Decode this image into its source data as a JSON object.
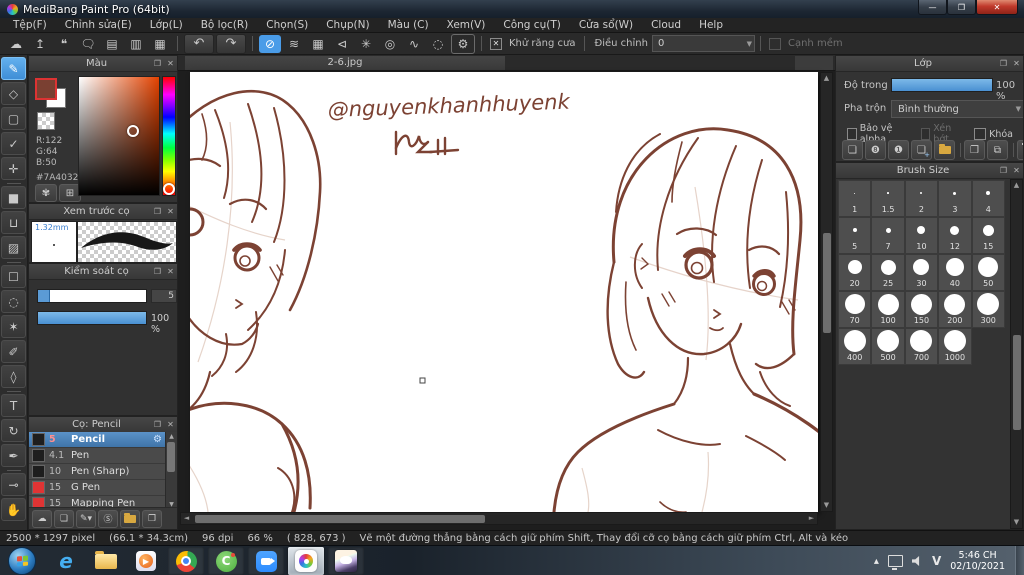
{
  "window": {
    "title": "MediBang Paint Pro (64bit)"
  },
  "menu": {
    "items": [
      "Tệp(F)",
      "Chỉnh sửa(E)",
      "Lớp(L)",
      "Bộ lọc(R)",
      "Chọn(S)",
      "Chụp(N)",
      "Màu (C)",
      "Xem(V)",
      "Công cụ(T)",
      "Cửa sổ(W)",
      "Cloud",
      "Help"
    ]
  },
  "toolbar": {
    "groups": [
      {
        "items": [
          {
            "name": "cloud-save-icon",
            "glyph": "☁"
          },
          {
            "name": "upload-icon",
            "glyph": "↥"
          },
          {
            "name": "comment-icon",
            "glyph": "❝"
          },
          {
            "name": "comment-list-icon",
            "glyph": "🗨"
          },
          {
            "name": "document-icon",
            "glyph": "▤"
          },
          {
            "name": "panel-list-icon",
            "glyph": "▥"
          },
          {
            "name": "table-edit-icon",
            "glyph": "▦"
          }
        ]
      },
      {
        "items": [
          {
            "name": "undo-icon",
            "glyph": "↶",
            "wide": true
          },
          {
            "name": "redo-icon",
            "glyph": "↷",
            "wide": true
          }
        ]
      },
      {
        "items": [
          {
            "name": "snap-off-icon",
            "glyph": "⊘",
            "active": true
          },
          {
            "name": "snap-parallel-icon",
            "glyph": "≋"
          },
          {
            "name": "snap-grid-icon",
            "glyph": "▦"
          },
          {
            "name": "snap-vanishing-icon",
            "glyph": "⊲"
          },
          {
            "name": "snap-radial-icon",
            "glyph": "✳"
          },
          {
            "name": "snap-concentric-icon",
            "glyph": "◎"
          },
          {
            "name": "snap-curve-icon",
            "glyph": "∿"
          },
          {
            "name": "snap-ellipse-icon",
            "glyph": "◌"
          },
          {
            "name": "snap-settings-icon",
            "glyph": "⚙",
            "boxed": true
          }
        ]
      }
    ],
    "antialias_label": "Khử răng cưa",
    "antialias_checked": true,
    "adjust_label": "Điều chỉnh",
    "adjust_value": "0",
    "soft_edge_label": "Cạnh mềm",
    "soft_edge_checked": false
  },
  "toolstrip": {
    "tools": [
      {
        "name": "brush-tool",
        "glyph": "✎",
        "selected": true
      },
      {
        "name": "eraser-tool",
        "glyph": "◇"
      },
      {
        "name": "shape-brush-tool",
        "glyph": "▢"
      },
      {
        "name": "snap-pen-tool",
        "glyph": "✓"
      },
      {
        "name": "move-tool",
        "glyph": "✛",
        "sep_after": true
      },
      {
        "name": "fill-rect-tool",
        "glyph": "■"
      },
      {
        "name": "bucket-tool",
        "glyph": "⊔"
      },
      {
        "name": "gradient-tool",
        "glyph": "▨",
        "sep_after": true
      },
      {
        "name": "select-rect-tool",
        "glyph": "☐"
      },
      {
        "name": "lasso-tool",
        "glyph": "◌"
      },
      {
        "name": "magic-wand-tool",
        "glyph": "✶"
      },
      {
        "name": "select-pen-tool",
        "glyph": "✐"
      },
      {
        "name": "select-eraser-tool",
        "glyph": "◊",
        "sep_after": true
      },
      {
        "name": "text-tool",
        "glyph": "T"
      },
      {
        "name": "operation-tool",
        "glyph": "↻"
      },
      {
        "name": "line-pen-tool",
        "glyph": "✒",
        "sep_after": true
      },
      {
        "name": "eyedropper-tool",
        "glyph": "⊸"
      },
      {
        "name": "hand-tool",
        "glyph": "✋"
      }
    ]
  },
  "color_panel": {
    "title": "Màu",
    "r": "R:122",
    "g": "G:64",
    "b": "B:50",
    "hex": "#7A4032",
    "buttons": [
      {
        "name": "palette-icon",
        "glyph": "✾"
      },
      {
        "name": "palette-add-icon",
        "glyph": "⊞"
      }
    ]
  },
  "brush_preview": {
    "title": "Xem trước cọ",
    "size_label": "1.32mm"
  },
  "brush_control": {
    "title": "Kiểm soát cọ",
    "size_value": "5",
    "opacity_value": "100 %"
  },
  "brush_list": {
    "title": "Cọ: Pencil",
    "items": [
      {
        "size": "5",
        "name": "Pencil",
        "selected": true,
        "swatch": "#1e1e1e"
      },
      {
        "size": "4.1",
        "name": "Pen",
        "swatch": "#1e1e1e"
      },
      {
        "size": "10",
        "name": "Pen (Sharp)",
        "swatch": "#1e1e1e"
      },
      {
        "size": "15",
        "name": "G Pen",
        "swatch": "#e03434"
      },
      {
        "size": "15",
        "name": "Mapping Pen",
        "swatch": "#e03434"
      }
    ],
    "footer_icons": [
      {
        "name": "cloud-brush-icon",
        "glyph": "☁"
      },
      {
        "name": "new-brush-icon",
        "glyph": "❏"
      },
      {
        "name": "edit-brush-icon",
        "glyph": "✎▾"
      },
      {
        "name": "script-brush-icon",
        "glyph": "Ⓢ"
      },
      {
        "name": "brush-folder-icon",
        "kind": "folder"
      },
      {
        "name": "duplicate-brush-icon",
        "glyph": "❐"
      }
    ]
  },
  "canvas": {
    "tab": "2-6.jpg",
    "signature": "@nguyenkhanhhuyenk"
  },
  "layer_panel": {
    "title": "Lớp",
    "opacity_label": "Độ trong",
    "opacity_value": "100 %",
    "blend_label": "Pha trộn",
    "blend_value": "Bình thường",
    "checkboxes": [
      {
        "label": "Bảo vệ alpha",
        "checked": false,
        "disabled": false
      },
      {
        "label": "Xén bớt",
        "checked": false,
        "disabled": true
      },
      {
        "label": "Khóa",
        "checked": false,
        "disabled": false
      }
    ],
    "icons": [
      {
        "name": "new-layer-icon",
        "glyph": "❏"
      },
      {
        "name": "8bit-layer-icon",
        "glyph": "❽"
      },
      {
        "name": "1bit-layer-icon",
        "glyph": "❶"
      },
      {
        "name": "add-layer-icon",
        "glyph": "❏",
        "plus": true
      },
      {
        "name": "layer-folder-icon",
        "kind": "folder"
      },
      {
        "sep": true
      },
      {
        "name": "duplicate-layer-icon",
        "glyph": "❐"
      },
      {
        "name": "combine-layer-icon",
        "glyph": "⧉"
      },
      {
        "sep": true
      },
      {
        "name": "delete-layer-icon",
        "kind": "trash"
      }
    ]
  },
  "brush_size_panel": {
    "title": "Brush Size",
    "sizes": [
      "1",
      "1.5",
      "2",
      "3",
      "4",
      "5",
      "7",
      "10",
      "12",
      "15",
      "20",
      "25",
      "30",
      "40",
      "50",
      "70",
      "100",
      "150",
      "200",
      "300",
      "400",
      "500",
      "700",
      "1000"
    ]
  },
  "status_bar": {
    "segments": [
      "2500 * 1297 pixel",
      "(66.1 * 34.3cm)",
      "96 dpi",
      "66 %",
      "( 828, 673 )",
      "Vẽ một đường thẳng bằng cách giữ phím Shift, Thay đổi cỡ cọ bằng cách giữ phím Ctrl, Alt và kéo"
    ]
  },
  "taskbar": {
    "icons": [
      {
        "name": "taskbar-ie-icon",
        "kind": "ie",
        "label": "e"
      },
      {
        "name": "taskbar-explorer-icon",
        "kind": "folder"
      },
      {
        "name": "taskbar-wmp-icon",
        "kind": "wmp",
        "label": "▶"
      },
      {
        "name": "taskbar-chrome-icon",
        "kind": "chrome",
        "running": true
      },
      {
        "name": "taskbar-coccoc-icon",
        "kind": "coccoc",
        "label": "C",
        "running": true
      },
      {
        "name": "taskbar-zoom-icon",
        "kind": "zoom",
        "running": true
      },
      {
        "name": "taskbar-medibang-icon",
        "kind": "medibang",
        "active": true
      },
      {
        "name": "taskbar-avatar-icon",
        "kind": "avatar",
        "running": true
      }
    ],
    "lang": "V",
    "clock_time": "5:46 CH",
    "clock_date": "02/10/2021"
  },
  "colors": {
    "accent_blue": "#4a9ce8",
    "selection_blue": "#3f74a8",
    "sketch_brown": "#7c4233",
    "foreground_swatch": "#7A4032"
  }
}
